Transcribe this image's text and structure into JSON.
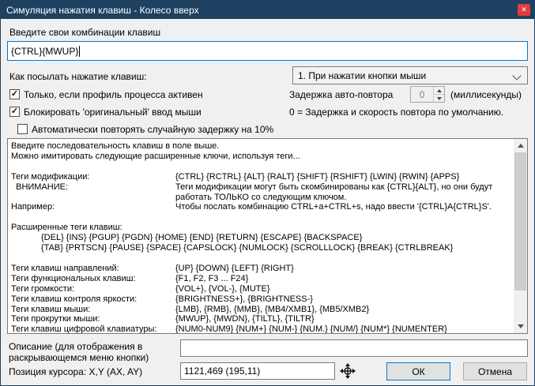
{
  "window": {
    "title": "Симуляция нажатия клавиш - Колесо вверх",
    "close_glyph": "✕"
  },
  "colors": {
    "titlebar": "#1e4061",
    "close": "#e03e3e",
    "accent": "#0078d7"
  },
  "form": {
    "keys_label": "Введите свои комбинации клавиш",
    "keys_value": "{CTRL}{MWUP}",
    "send_label": "Как посылать нажатие клавиш:",
    "send_value": "1. При нажатии кнопки мыши",
    "profile_checkbox": {
      "label": "Только, если профиль процесса активен",
      "checked": true,
      "glyph": "✓"
    },
    "block_checkbox": {
      "label": "Блокировать 'оригинальный' ввод мыши",
      "checked": true,
      "glyph": "✓"
    },
    "repeat_checkbox": {
      "label": "Автоматически повторять случайную задержку на 10%",
      "checked": false,
      "glyph": ""
    },
    "delay_label": "Задержка авто-повтора",
    "delay_value": "0",
    "delay_units": "(миллисекунды)",
    "delay_hint": "0 = Задержка и скорость повтора по умолчанию."
  },
  "help": {
    "rows": [
      {
        "c1": "Введите последовательность клавиш в поле выше.",
        "c2": ""
      },
      {
        "c1": "Можно имитировать следующие расширенные ключи, используя теги...",
        "c2": ""
      },
      {
        "c1": "",
        "c2": ""
      },
      {
        "c1": "Теги модификации:",
        "c2": "{CTRL} {RCTRL} {ALT} {RALT} {SHIFT} {RSHIFT} {LWIN} {RWIN} {APPS}"
      },
      {
        "c1": "  ВНИМАНИЕ:",
        "c2": "Теги модификации могут быть скомбинированы как {CTRL}{ALT}, но они будут"
      },
      {
        "c1": "",
        "c2": "работать ТОЛЬКО со следующим ключом."
      },
      {
        "c1": "Например:",
        "c2": "Чтобы послать комбинацию CTRL+a+CTRL+s, надо ввести '{CTRL}A{CTRL}S'."
      },
      {
        "c1": "",
        "c2": ""
      },
      {
        "c1": "Расширенные теги клавиш:",
        "c2": ""
      },
      {
        "c1": "{DEL} {INS} {PGUP} {PGDN} {HOME} {END} {RETURN} {ESCAPE} {BACKSPACE}",
        "c2": ""
      },
      {
        "c1": "{TAB} {PRTSCN} {PAUSE} {SPACE} {CAPSLOCK} {NUMLOCK} {SCROLLLOCK} {BREAK} {CTRLBREAK}",
        "c2": ""
      },
      {
        "c1": "",
        "c2": ""
      },
      {
        "c1": "Теги клавиш направлений:",
        "c2": "{UP} {DOWN} {LEFT} {RIGHT}"
      },
      {
        "c1": "Теги функциональных клавиш:",
        "c2": "{F1, F2, F3 ... F24}"
      },
      {
        "c1": "Теги громкости:",
        "c2": "{VOL+}, {VOL-}, {MUTE}"
      },
      {
        "c1": "Теги клавиш контроля яркости:",
        "c2": "{BRIGHTNESS+}, {BRIGHTNESS-}"
      },
      {
        "c1": "Теги клавиш мыши:",
        "c2": "{LMB}, {RMB}, {MMB}, {MB4/XMB1}, {MB5/XMB2}"
      },
      {
        "c1": "Теги прокрутки мыши:",
        "c2": "{MWUP}, {MWDN}, {TILTL}, {TILTR}"
      },
      {
        "c1": "Теги клавиш цифровой клавиатуры:",
        "c2": "{NUM0-NUM9} {NUM+} {NUM-} {NUM.} {NUM/} {NUM*} {NUMENTER}"
      }
    ]
  },
  "footer": {
    "description_label_1": "Описание (для отображения в",
    "description_label_2": "раскрывающемся меню кнопки)",
    "description_value": "",
    "position_label": "Позиция курсора: X,Y (AX, AY)",
    "position_value": "1121,469 (195,11)",
    "ok": "ОК",
    "cancel": "Отмена"
  }
}
